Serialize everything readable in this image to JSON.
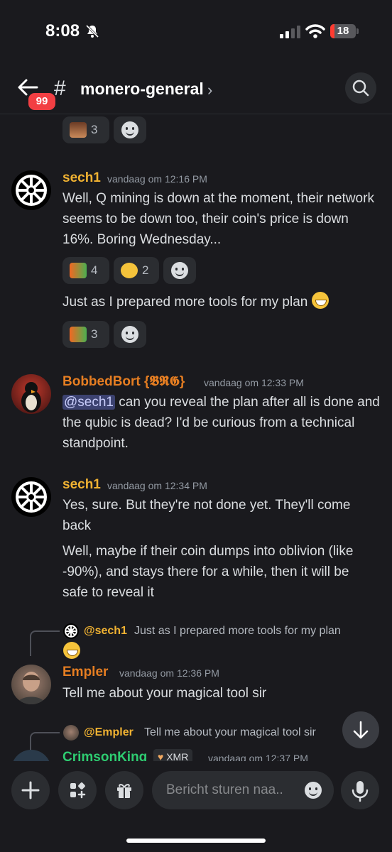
{
  "status": {
    "time": "8:08",
    "battery": "18",
    "battery_level": 0.18
  },
  "header": {
    "badge": "99",
    "hash": "#",
    "channel": "monero-general",
    "chevron": "›"
  },
  "top_reactions": [
    {
      "count": "3",
      "icon": "meme-face"
    }
  ],
  "messages": [
    {
      "author": "sech1",
      "author_color": "#f0b232",
      "timestamp": "vandaag om 12:16 PM",
      "text1": "Well, Q mining is down at the moment, their network seems to be down too, their coin's price is down 16%. Boring Wednesday...",
      "reactions1": [
        {
          "icon": "monero-pepe",
          "count": "4"
        },
        {
          "icon": "winking-face",
          "count": "2"
        }
      ],
      "text2": "Just as I prepared more tools for my plan",
      "reactions2": [
        {
          "icon": "monero-pepe",
          "count": "3"
        }
      ]
    },
    {
      "author": "BobbedBort",
      "author_tag": "{𝕭𝕽𝕲}",
      "author_color": "#e67e22",
      "timestamp": "vandaag om 12:33 PM",
      "mention": "@sech1",
      "text": "can you reveal the plan after all is done and the qubic is dead? I'd be curious from a technical standpoint."
    },
    {
      "author": "sech1",
      "author_color": "#f0b232",
      "timestamp": "vandaag om 12:34 PM",
      "text1": "Yes, sure. But they're not done yet. They'll come back",
      "text2": "Well, maybe if their coin dumps into oblivion (like -90%), and stays there for a while, then it will be safe to reveal it"
    },
    {
      "reply_to": "@sech1",
      "reply_text": "Just as I prepared more tools for my plan",
      "author": "Empler",
      "author_color": "#e67e22",
      "timestamp": "vandaag om 12:36 PM",
      "text": "Tell me about your magical tool sir"
    },
    {
      "reply_to": "@Empler",
      "reply_text": "Tell me about your magical tool sir",
      "author": "CrimsonKing",
      "author_color": "#2ecc71",
      "tag": "XMR",
      "timestamp": "vandaag om 12:37 PM"
    }
  ],
  "composer": {
    "placeholder": "Bericht sturen naa.."
  },
  "colors": {
    "accent_red": "#f23f43",
    "mention_bg": "#3c4270",
    "background": "#1a1a1e"
  }
}
